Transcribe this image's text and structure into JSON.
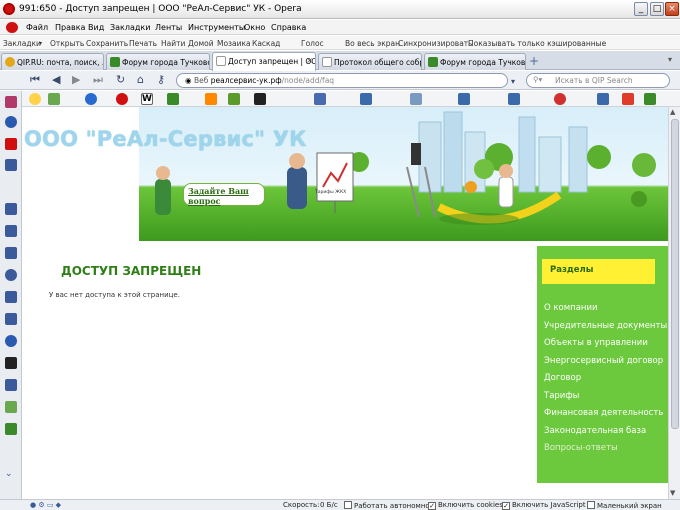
{
  "window": {
    "title": "991:650 - Доступ запрещен | ООО \"РеАл-Сервис\" УК - Opera"
  },
  "menu": [
    "Файл",
    "Правка",
    "Вид",
    "Закладки",
    "Ленты",
    "Инструменты",
    "Окно",
    "Справка"
  ],
  "bookmark_toolbar": [
    "Закладки",
    "Открыть",
    "Сохранить",
    "Печать",
    "Найти",
    "Домой",
    "Мозаика",
    "Каскад",
    "Голос",
    "Во весь экран",
    "Синхронизировать",
    "Показывать только кэшированные"
  ],
  "tabs": [
    {
      "label": "QIP.RU: почта, поиск, ...",
      "active": false,
      "color": "#e2a81a"
    },
    {
      "label": "Форум города Тучково ...",
      "active": false,
      "color": "#3a8a2a"
    },
    {
      "label": "Доступ запрещен | ОО...",
      "active": true,
      "color": "#ffffff"
    },
    {
      "label": "Протокол общего собр...",
      "active": false,
      "color": "#ffffff"
    },
    {
      "label": "Форум города Тучково ...",
      "active": false,
      "color": "#3a8a2a"
    }
  ],
  "address": {
    "prefix": "Веб",
    "host": "реалсервис-ук.рф",
    "path": "/node/add/faq"
  },
  "search": {
    "placeholder": "Искать в QIP Search"
  },
  "site": {
    "brand": "ООО \"РеАл-Сервис\" УК",
    "ask_question": "Задайте Ваш вопрос",
    "chart_sign": "Тарифы ЖКХ",
    "heading": "ДОСТУП ЗАПРЕЩЕН",
    "message": "У вас нет доступа к этой странице.",
    "sidebar_title": "Разделы",
    "sections": [
      "О компании",
      "Учредительные документы",
      "Объекты в управлении",
      "Энергосервисный договор",
      "Договор",
      "Тарифы",
      "Финансовая деятельность",
      "Законодательная база",
      "Вопросы-ответы"
    ]
  },
  "status": {
    "speed_label": "Скорость:",
    "speed_value": "0 Б/с",
    "offline": "Работать автономно",
    "cookies": "Включить cookies",
    "javascript": "Включить JavaScript",
    "small_screen": "Маленький экран"
  },
  "colors": {
    "accent_green": "#2f7f17",
    "sidebar_green": "#6cc83c",
    "sidebar_head": "#fff033",
    "brand_blue": "#9fd5ec"
  }
}
